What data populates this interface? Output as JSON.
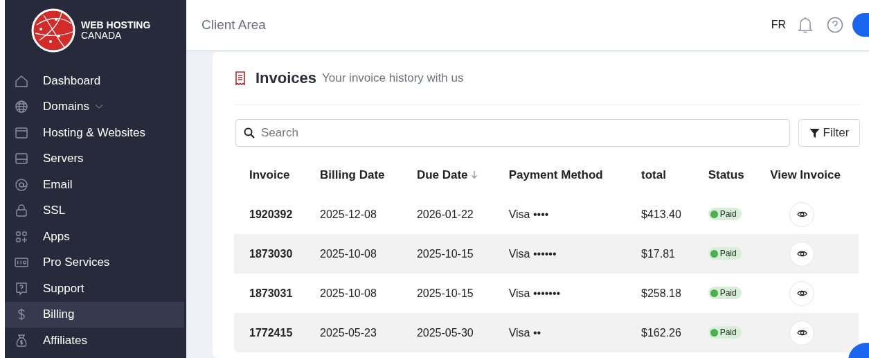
{
  "logo": {
    "line1": "WEB HOSTING",
    "line2": "CANADA"
  },
  "sidebar": {
    "items": [
      {
        "label": "Dashboard",
        "kind": "home",
        "has_submenu": false,
        "selected": false
      },
      {
        "label": "Domains",
        "kind": "globe",
        "has_submenu": true,
        "selected": false
      },
      {
        "label": "Hosting & Websites",
        "kind": "browser",
        "has_submenu": false,
        "selected": false
      },
      {
        "label": "Servers",
        "kind": "server",
        "has_submenu": false,
        "selected": false
      },
      {
        "label": "Email",
        "kind": "at",
        "has_submenu": false,
        "selected": false
      },
      {
        "label": "SSL",
        "kind": "lock",
        "has_submenu": false,
        "selected": false
      },
      {
        "label": "Apps",
        "kind": "apps",
        "has_submenu": false,
        "selected": false
      },
      {
        "label": "Pro Services",
        "kind": "pro",
        "has_submenu": false,
        "selected": false
      },
      {
        "label": "Support",
        "kind": "support",
        "has_submenu": false,
        "selected": false
      },
      {
        "label": "Billing",
        "kind": "dollar",
        "has_submenu": false,
        "selected": true
      },
      {
        "label": "Affiliates",
        "kind": "moneybag",
        "has_submenu": false,
        "selected": false
      }
    ]
  },
  "header": {
    "title": "Client Area",
    "language": "FR"
  },
  "page": {
    "title": "Invoices",
    "subtitle": "Your invoice history with us"
  },
  "search": {
    "placeholder": "Search"
  },
  "filter_button": "Filter",
  "table": {
    "columns": [
      {
        "label": "Invoice",
        "sorted": false
      },
      {
        "label": "Billing Date",
        "sorted": false
      },
      {
        "label": "Due Date",
        "sorted": true
      },
      {
        "label": "Payment Method",
        "sorted": false
      },
      {
        "label": "total",
        "sorted": false
      },
      {
        "label": "Status",
        "sorted": false
      },
      {
        "label": "View Invoice",
        "sorted": false
      }
    ],
    "rows": [
      {
        "invoice": "1920392",
        "billing_date": "2025-12-08",
        "due_date": "2026-01-22",
        "payment_method": "Visa ••••",
        "total": "$413.40",
        "status": "Paid",
        "kind": "paid"
      },
      {
        "invoice": "1873030",
        "billing_date": "2025-10-08",
        "due_date": "2025-10-15",
        "payment_method": "Visa ••••••",
        "total": "$17.81",
        "status": "Paid",
        "kind": "paid"
      },
      {
        "invoice": "1873031",
        "billing_date": "2025-10-08",
        "due_date": "2025-10-15",
        "payment_method": "Visa •••••••",
        "total": "$258.18",
        "status": "Paid",
        "kind": "paid"
      },
      {
        "invoice": "1772415",
        "billing_date": "2025-05-23",
        "due_date": "2025-05-30",
        "payment_method": "Visa ••",
        "total": "$162.26",
        "status": "Paid",
        "kind": "paid"
      }
    ]
  }
}
